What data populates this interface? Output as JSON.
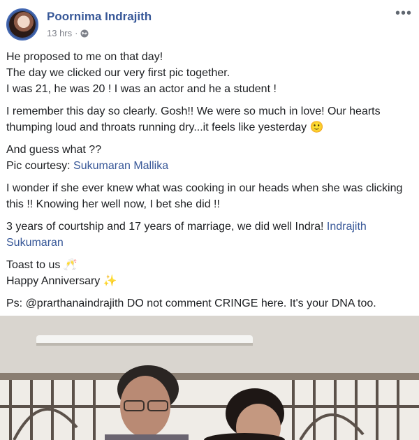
{
  "post": {
    "author": "Poornima Indrajith",
    "time": "13 hrs",
    "separator": "·",
    "more_icon": "more-horizontal-icon",
    "privacy_icon": "globe-icon"
  },
  "body": {
    "p1": {
      "l1": "He proposed to me on that day!",
      "l2": "The day we clicked our very first pic together.",
      "l3": "I was 21, he was 20 ! I was an actor and he a student !"
    },
    "p2": {
      "text": "I remember this day so clearly. Gosh!! We were so much in love! Our hearts thumping loud and throats running dry...it feels like yesterday",
      "emoji": "🙂"
    },
    "p3": {
      "l1": "And guess what ??",
      "courtesy_label": "Pic courtesy:",
      "courtesy_link": "Sukumaran Mallika"
    },
    "p4": {
      "text": "I wonder if she ever knew what was cooking in our heads when she was clicking this !! Knowing her well now, I bet she did !!"
    },
    "p5": {
      "text": "3 years of courtship and 17 years of marriage, we did well Indra!",
      "link": "Indrajith Sukumaran"
    },
    "p6": {
      "l1": "Toast to us",
      "l1_emoji": "🥂",
      "l2": "Happy Anniversary",
      "l2_emoji": "✨"
    },
    "p7": {
      "text": "Ps: @prarthanaindrajith DO not comment CRINGE here. It's your DNA too."
    }
  },
  "colors": {
    "link": "#385898",
    "meta": "#7d8089",
    "text": "#1c1e21"
  }
}
